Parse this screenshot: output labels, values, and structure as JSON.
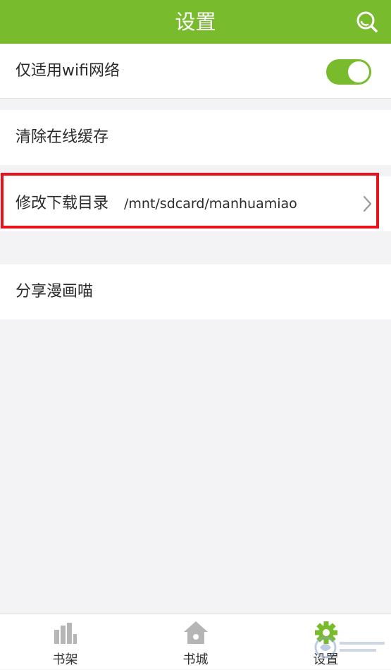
{
  "header": {
    "title": "设置",
    "search_icon": "search-icon"
  },
  "settings": {
    "wifi_only": {
      "label": "仅适用wifi网络",
      "enabled": true
    },
    "clear_cache": {
      "label": "清除在线缓存"
    },
    "download_dir": {
      "label": "修改下载目录",
      "value": "/mnt/sdcard/manhuamiao"
    },
    "share": {
      "label": "分享漫画喵"
    }
  },
  "tabs": [
    {
      "label": "书架",
      "icon": "bookshelf-icon"
    },
    {
      "label": "书城",
      "icon": "home-icon"
    },
    {
      "label": "设置",
      "icon": "gear-icon",
      "active": true
    }
  ],
  "colors": {
    "accent": "#78bb2d",
    "highlight": "#e8121a",
    "background": "#f3f3f5"
  }
}
